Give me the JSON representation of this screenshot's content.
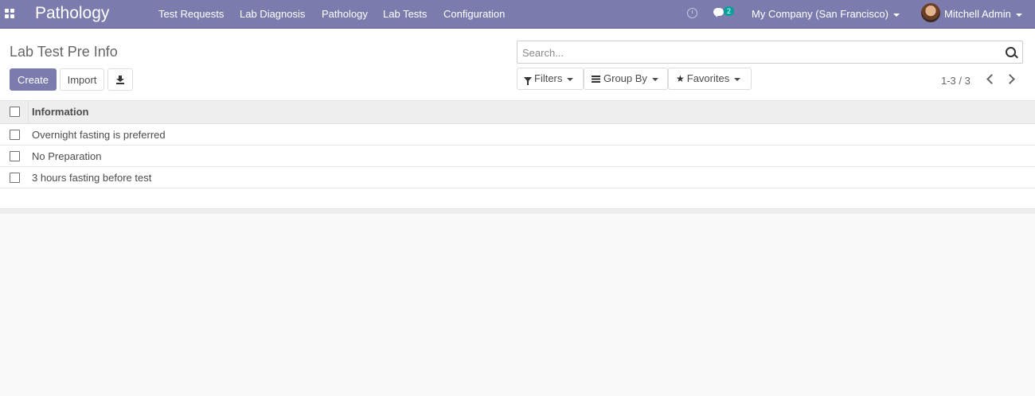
{
  "navbar": {
    "brand": "Pathology",
    "menu": [
      "Test Requests",
      "Lab Diagnosis",
      "Pathology",
      "Lab Tests",
      "Configuration"
    ],
    "chat_badge": "2",
    "company": "My Company (San Francisco)",
    "user": "Mitchell Admin"
  },
  "control": {
    "title": "Lab Test Pre Info",
    "create_label": "Create",
    "import_label": "Import",
    "search_placeholder": "Search...",
    "filters_label": "Filters",
    "groupby_label": "Group By",
    "favorites_label": "Favorites",
    "pager": "1-3 / 3"
  },
  "list": {
    "column": "Information",
    "rows": [
      "Overnight fasting is preferred",
      "No Preparation",
      "3 hours fasting before test"
    ]
  },
  "colors": {
    "brand": "#7c7bad",
    "badge": "#00a09d"
  }
}
